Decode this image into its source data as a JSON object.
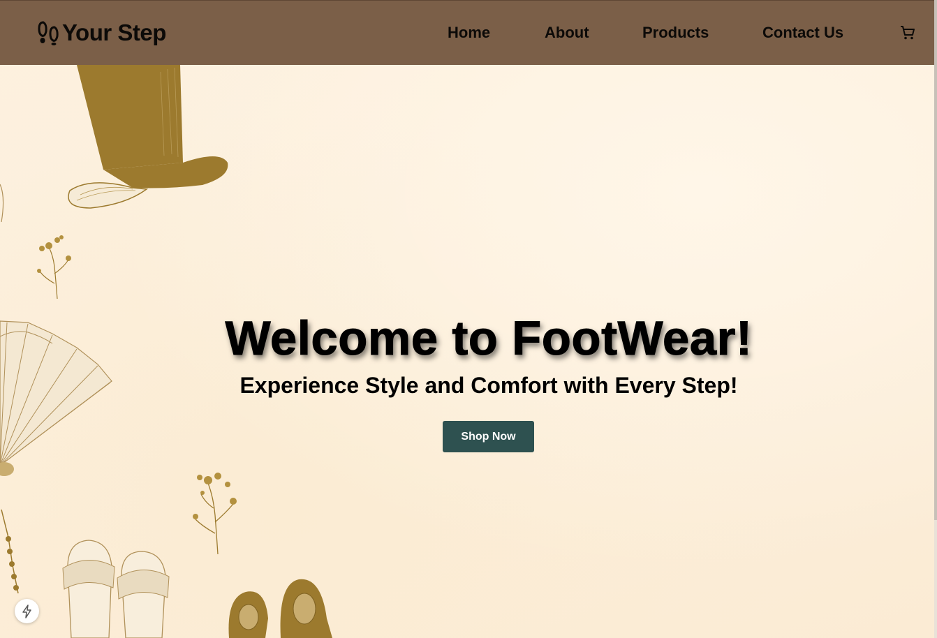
{
  "brand": {
    "logo_icon": "footprints-icon",
    "name": "Your Step"
  },
  "nav": {
    "items": [
      {
        "label": "Home"
      },
      {
        "label": "About"
      },
      {
        "label": "Products"
      },
      {
        "label": "Contact Us"
      }
    ],
    "cart_icon": "shopping-cart-icon"
  },
  "hero": {
    "title": "Welcome to FootWear!",
    "subtitle": "Experience Style and Comfort with Every Step!",
    "cta_label": "Shop Now"
  },
  "floating_button": {
    "icon": "lightning-bolt-icon"
  },
  "colors": {
    "navbar": "#7b5f48",
    "background": "#fdf2e0",
    "button": "#2e5150",
    "illustration_gold": "#9c7a2e"
  }
}
